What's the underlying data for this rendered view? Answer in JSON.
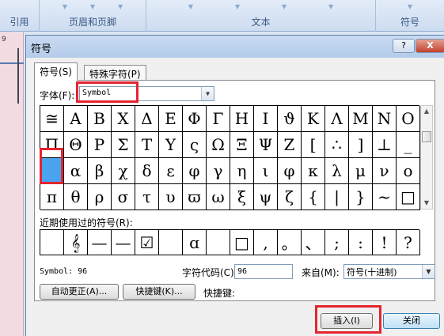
{
  "ribbon": {
    "groups": [
      "引用",
      "页眉和页脚",
      "文本",
      "符号"
    ],
    "ruler_mark": "9"
  },
  "dialog": {
    "title": "符号",
    "help_label": "?",
    "close_label": "X"
  },
  "tabs": [
    {
      "label": "符号(S)"
    },
    {
      "label": "特殊字符(P)"
    }
  ],
  "font": {
    "label": "字体(F):",
    "value": "Symbol"
  },
  "symbols": [
    "≅",
    "A",
    "B",
    "Χ",
    "Δ",
    "Ε",
    "Φ",
    "Γ",
    "Η",
    "Ι",
    "ϑ",
    "Κ",
    "Λ",
    "Μ",
    "Ν",
    "Ο",
    "Π",
    "Θ",
    "Ρ",
    "Σ",
    "Τ",
    "Υ",
    "ς",
    "Ω",
    "Ξ",
    "Ψ",
    "Ζ",
    "[",
    "∴",
    "]",
    "⊥",
    "_",
    "",
    "α",
    "β",
    "χ",
    "δ",
    "ε",
    "φ",
    "γ",
    "η",
    "ι",
    "φ",
    "κ",
    "λ",
    "μ",
    "ν",
    "ο",
    "π",
    "θ",
    "ρ",
    "σ",
    "τ",
    "υ",
    "ϖ",
    "ω",
    "ξ",
    "ψ",
    "ζ",
    "{",
    "|",
    "}",
    "~",
    "□"
  ],
  "recent": {
    "label": "近期使用过的符号(R):",
    "symbols": [
      "",
      "𝄞",
      "—",
      "—",
      "☑",
      "",
      "ɑ",
      "",
      "□",
      ",",
      "。",
      "、",
      ";",
      ":",
      "!",
      "?"
    ]
  },
  "info": {
    "symbol_desc": "Symbol: 96",
    "code_label": "字符代码(C):",
    "code_value": "96",
    "from_label": "来自(M):",
    "from_value": "符号(十进制)"
  },
  "buttons": {
    "autocorrect": "自动更正(A)...",
    "shortcut": "快捷键(K)...",
    "shortcut_label": "快捷键:",
    "insert": "插入(I)",
    "close": "关闭"
  }
}
